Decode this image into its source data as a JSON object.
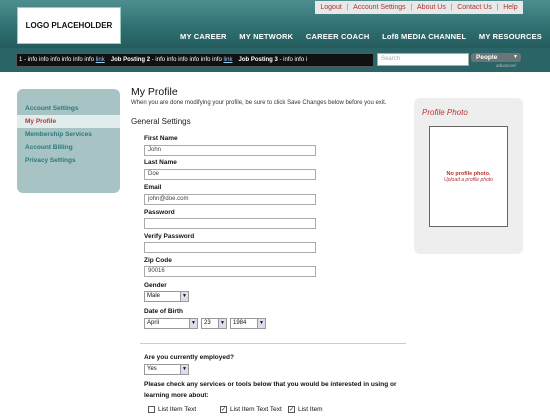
{
  "header": {
    "logo": "LOGO PLACEHOLDER",
    "toplinks": [
      "Logout",
      "Account Settings",
      "About Us",
      "Contact Us",
      "Help"
    ],
    "mainnav": [
      "MY CAREER",
      "MY NETWORK",
      "CAREER COACH",
      "Lof8 MEDIA CHANNEL",
      "MY RESOURCES"
    ]
  },
  "ticker": {
    "item1_text": "1 - info info info info info info",
    "item1_link": "link",
    "item2_title": "Job Posting 2",
    "item2_text": "- info info info info info info",
    "item2_link": "link",
    "item3_title": "Job Posting 3",
    "item3_text": "- info info i"
  },
  "search": {
    "placeholder": "Search",
    "scope": "People",
    "advanced": "advanced"
  },
  "sidebar": {
    "items": [
      {
        "label": "Account Settings"
      },
      {
        "label": "My Profile"
      },
      {
        "label": "Membership Services"
      },
      {
        "label": "Account Billing"
      },
      {
        "label": "Privacy Settings"
      }
    ]
  },
  "main": {
    "title": "My Profile",
    "intro": "When you are done modifying your profile, be sure to click Save Changes below before you exit.",
    "section": "General Settings"
  },
  "form": {
    "first_name_label": "First Name",
    "first_name": "John",
    "last_name_label": "Last Name",
    "last_name": "Doe",
    "email_label": "Email",
    "email": "john@doe.com",
    "password_label": "Password",
    "password": "",
    "verify_label": "Verify Password",
    "verify": "",
    "zip_label": "Zip Code",
    "zip": "90016",
    "gender_label": "Gender",
    "gender": "Male",
    "dob_label": "Date of Birth",
    "dob_month": "April",
    "dob_day": "23",
    "dob_year": "1984",
    "employed_q": "Are you currently employed?",
    "employed": "Yes",
    "services_q_line1": "Please check any services or tools below that you would be interested in using or",
    "services_q_line2": "learning more about:",
    "checkboxes": [
      {
        "label": "List Item Text",
        "checked": false
      },
      {
        "label": "List Item Text Text",
        "checked": true
      },
      {
        "label": "List Item",
        "checked": true
      }
    ]
  },
  "photo": {
    "title": "Profile Photo",
    "empty": "No profile photo.",
    "upload": "Upload a profile photo"
  }
}
